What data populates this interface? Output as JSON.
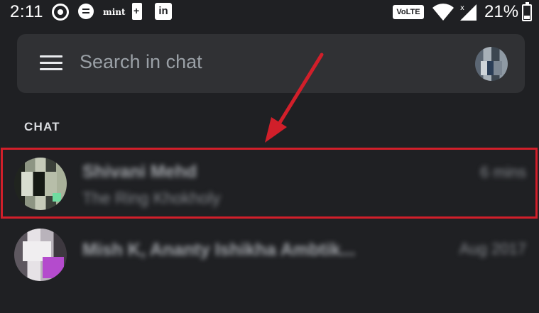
{
  "status_bar": {
    "time": "2:11",
    "notification_icons": [
      "whatsapp-icon",
      "message-icon",
      "mint-icon",
      "battery-saver-icon",
      "linkedin-icon"
    ],
    "mint_label": "mint",
    "linkedin_label": "in",
    "volte_label": "VoLTE",
    "battery_percent": "21%"
  },
  "search": {
    "placeholder": "Search in chat"
  },
  "section": {
    "title": "CHAT"
  },
  "chats": [
    {
      "name": "Shivani Mehd",
      "preview": "The Ring Khokholy",
      "time": "6 mins",
      "highlighted": true
    },
    {
      "name": "Mish K, Ananty Ishikha Ambtik...",
      "time": "Aug 2017"
    }
  ],
  "colors": {
    "background": "#1f2023",
    "search_bar": "#303134",
    "highlight": "#d11f2a",
    "arrow": "#d11f2a"
  }
}
